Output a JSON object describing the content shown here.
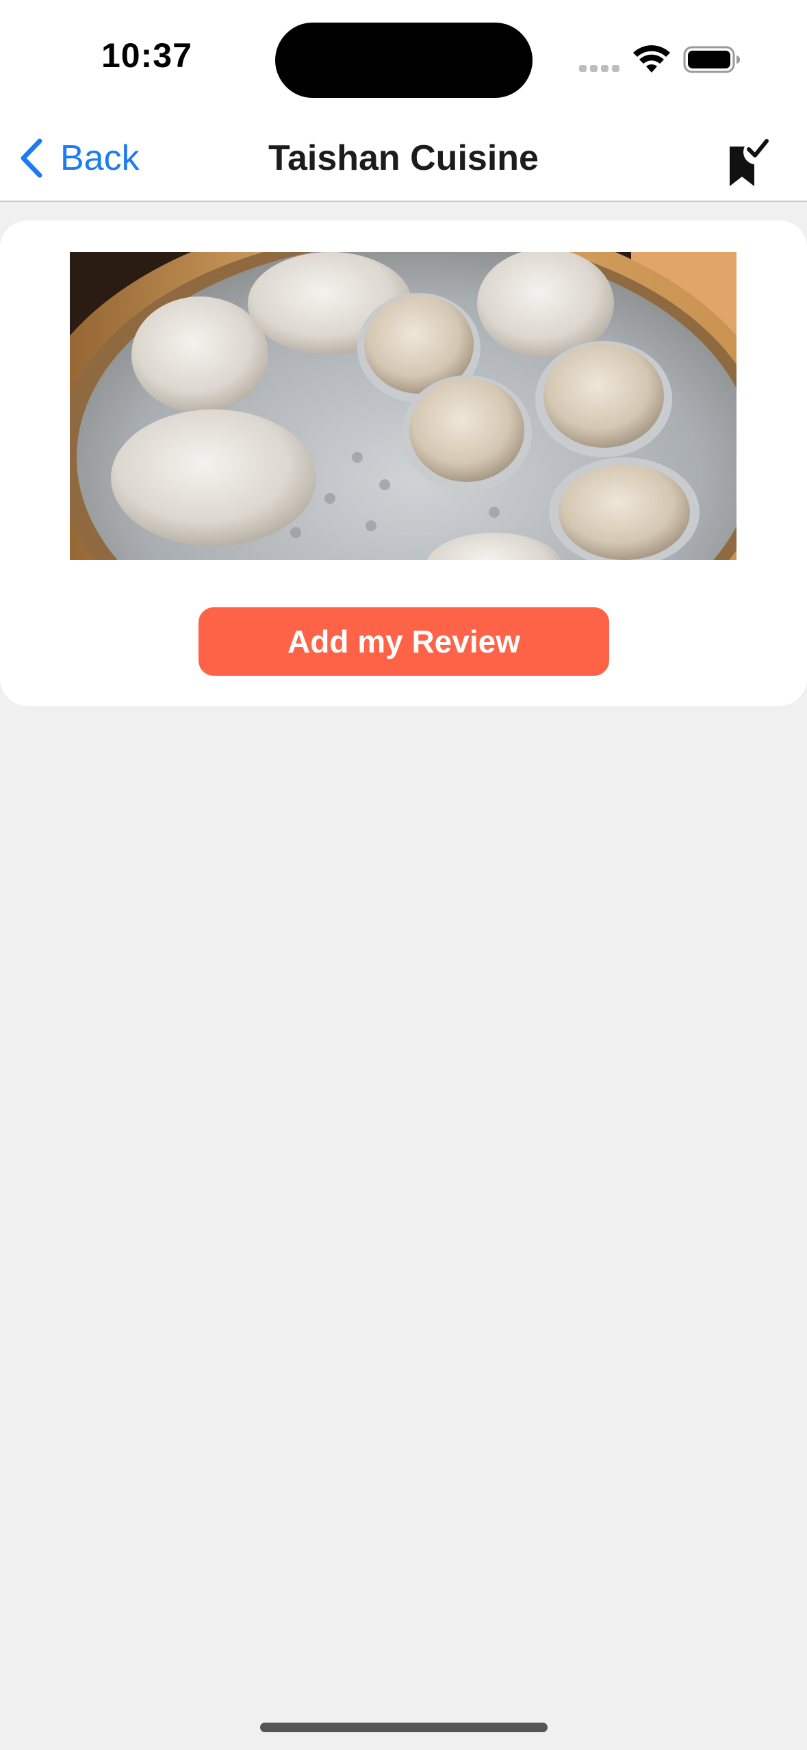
{
  "status_bar": {
    "time": "10:37",
    "icons": [
      "signal-dots-icon",
      "wifi-icon",
      "battery-icon"
    ]
  },
  "nav": {
    "back_label": "Back",
    "title": "Taishan Cuisine",
    "bookmark_icon": "bookmark-check-icon",
    "accent_color": "#1a7cf0"
  },
  "card": {
    "image_alt": "Steamed dim sum dumplings in a bamboo steamer",
    "review_button_label": "Add my Review",
    "review_button_color": "#fe6347"
  }
}
